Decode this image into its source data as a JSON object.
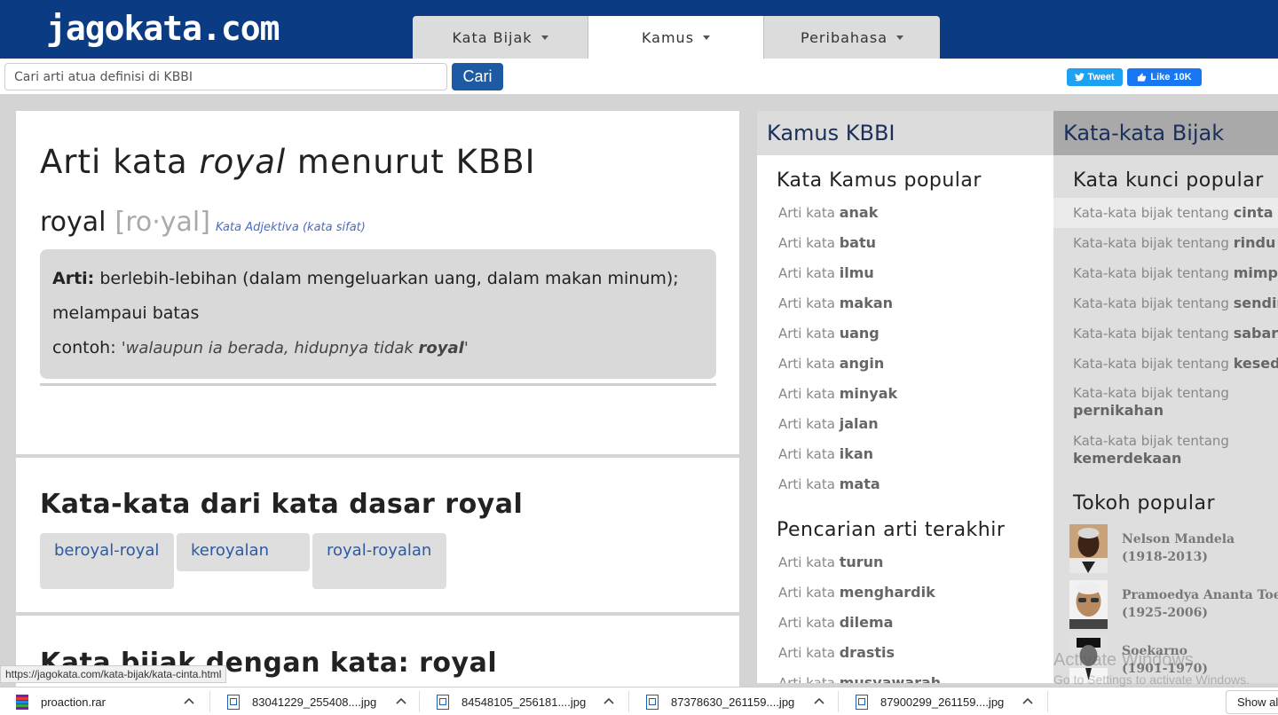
{
  "header": {
    "logo": "jagokata.com",
    "tabs": [
      {
        "label": "Kata Bijak"
      },
      {
        "label": "Kamus"
      },
      {
        "label": "Peribahasa"
      }
    ]
  },
  "search": {
    "placeholder": "Cari arti atua definisi di KBBI",
    "button": "Cari"
  },
  "social": {
    "tweet": "Tweet",
    "like": "Like",
    "like_count": "10K"
  },
  "entry": {
    "title_prefix": "Arti kata ",
    "title_word": "royal",
    "title_suffix": " menurut KBBI",
    "word": "royal",
    "syllables": "[ro·yal]",
    "word_class": "Kata Adjektiva (kata sifat)",
    "arti_label": "Arti:",
    "arti_text": "berlebih-lebihan (dalam mengeluarkan uang, dalam makan minum); melampaui batas",
    "contoh_label": "contoh:",
    "contoh_pre": "'walaupun ia berada, hidupnya tidak ",
    "contoh_word": "royal",
    "contoh_post": "'"
  },
  "derived": {
    "title_prefix": "Kata-kata dari kata dasar ",
    "title_word": "royal",
    "items": [
      "beroyal-royal",
      "keroyalan",
      "royal-royalan"
    ]
  },
  "quotes_section": {
    "title": "Kata bijak dengan kata: royal"
  },
  "kamus": {
    "header": "Kamus KBBI",
    "popular_title": "Kata Kamus popular",
    "link_prefix": "Arti kata",
    "popular": [
      "anak",
      "batu",
      "ilmu",
      "makan",
      "uang",
      "angin",
      "minyak",
      "jalan",
      "ikan",
      "mata"
    ],
    "recent_title": "Pencarian arti terakhir",
    "recent": [
      "turun",
      "menghardik",
      "dilema",
      "drastis",
      "musyawarah"
    ]
  },
  "bijak": {
    "header": "Kata-kata Bijak",
    "keywords_title": "Kata kunci popular",
    "link_prefix": "Kata-kata bijak tentang",
    "keywords": [
      "cinta",
      "rindu",
      "mimpi",
      "sendiri",
      "sabar",
      "kesedihan",
      "pernikahan",
      "kemerdekaan"
    ],
    "tokoh_title": "Tokoh popular",
    "tokoh": [
      {
        "name": "Nelson Mandela",
        "years": "(1918-2013)"
      },
      {
        "name": "Pramoedya Ananta Toer",
        "years": "(1925-2006)"
      },
      {
        "name": "Soekarno",
        "years": "(1901-1970)"
      }
    ]
  },
  "windows_watermark": {
    "line1": "Activate Windows",
    "line2": "Go to Settings to activate Windows."
  },
  "status_url": "https://jagokata.com/kata-bijak/kata-cinta.html",
  "downloads": {
    "items": [
      {
        "name": "proaction.rar",
        "icon": "rar-archive-icon"
      },
      {
        "name": "83041229_255408....jpg",
        "icon": "image-file-icon"
      },
      {
        "name": "84548105_256181....jpg",
        "icon": "image-file-icon"
      },
      {
        "name": "87378630_261159....jpg",
        "icon": "image-file-icon"
      },
      {
        "name": "87900299_261159....jpg",
        "icon": "image-file-icon"
      }
    ],
    "show_all": "Show all"
  }
}
